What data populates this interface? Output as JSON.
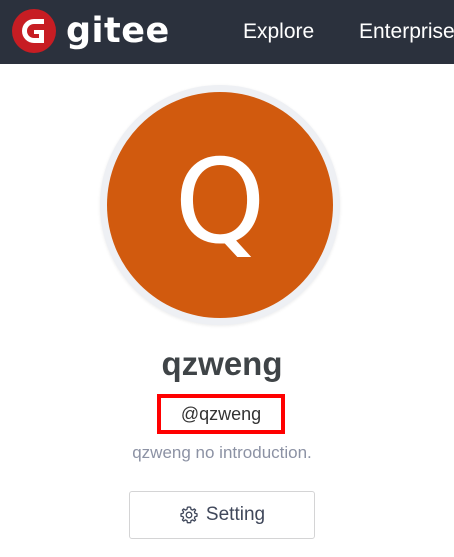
{
  "header": {
    "logo_text": "gitee",
    "logo_icon": "gitee-logo-icon",
    "nav": [
      {
        "label": "Explore"
      },
      {
        "label": "Enterprise"
      }
    ]
  },
  "profile": {
    "avatar_letter": "Q",
    "avatar_color": "#d15a0e",
    "username": "qzweng",
    "handle": "@qzweng",
    "bio": "qzweng no introduction.",
    "highlight_color": "#ff0000"
  },
  "actions": {
    "setting_label": "Setting",
    "setting_icon": "gear-icon"
  },
  "colors": {
    "topbar": "#2b313d",
    "brand_red": "#c71d23"
  }
}
